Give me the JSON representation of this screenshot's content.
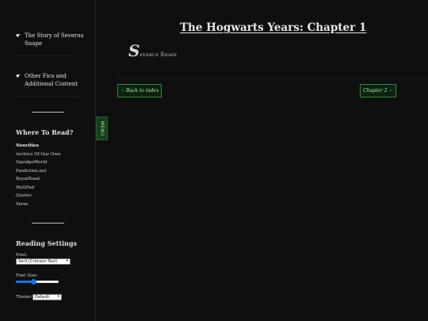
{
  "sidebar": {
    "links": [
      {
        "icon": "pointing-hand-icon",
        "glyph": "☛",
        "label": "The Story of Severus Snape"
      },
      {
        "icon": "pointing-hand-icon",
        "glyph": "☛",
        "label": "Other Fics and Additional Content"
      }
    ],
    "where_heading": "Where To Read?",
    "where_items": [
      "Neocities",
      "Archive Of Our Own",
      "SquidgeWorld",
      "Fanfiction.net",
      "RoyalRoad",
      "WattPad",
      "Quotev",
      "Verse"
    ],
    "active_item": "Neocities",
    "settings_heading": "Reading Settings",
    "font_label": "Font:",
    "font_value": "Serif (Crimson Text)",
    "font_size_label": "Font Size:",
    "font_size_percent": 40,
    "theme_label": "Theme:",
    "theme_value": "Default",
    "menu_toggle_label": "MENU"
  },
  "main": {
    "chapter_title": "The Hogwarts Years: Chapter 1",
    "author_initial": "S",
    "author_rest": "everus Snape",
    "back_button": "☜ Back to index",
    "next_button": "Chapter 2 ☞"
  },
  "colors": {
    "background": "#0f0f0f",
    "button_bg": "#0a220e",
    "button_border": "#2f8a3e",
    "menu_tab": "#15401c"
  }
}
